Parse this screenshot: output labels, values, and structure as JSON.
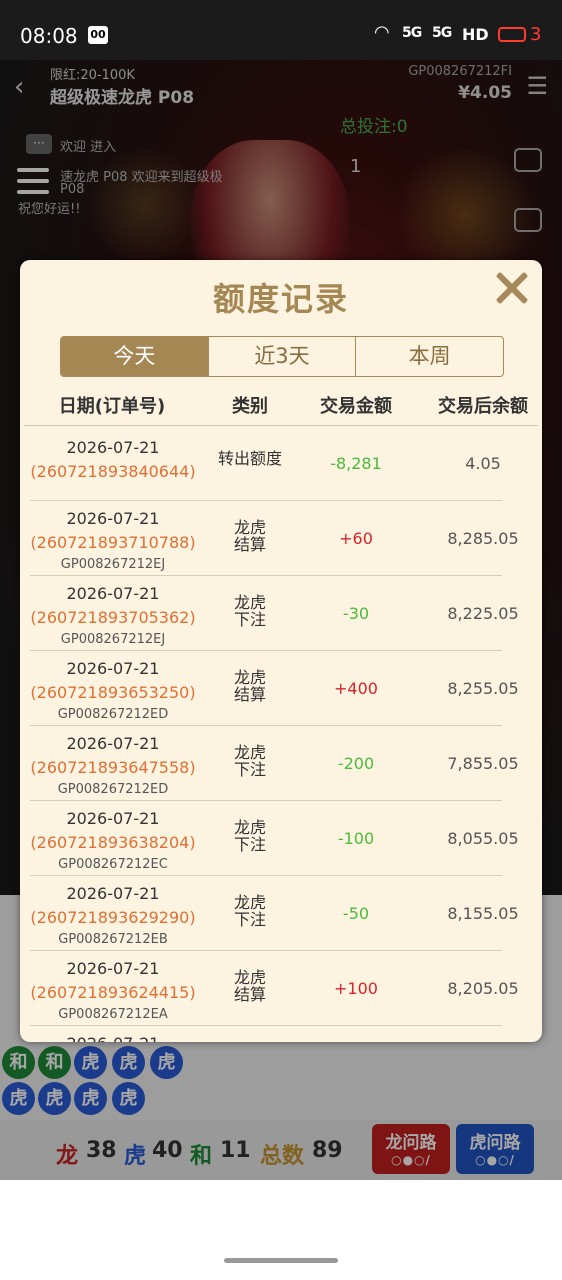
{
  "status_bar": {
    "time": "08:08",
    "app_icon": "00",
    "signal1": "5G",
    "signal2": "5G",
    "hd": "HD",
    "battery": "3"
  },
  "game": {
    "limit": "限红:20-100K",
    "title": "超级极速龙虎 P08",
    "gp_id": "GP008267212FI",
    "balance": "¥4.05",
    "total_bet": "总投注:0",
    "chat_line1": "欢迎 进入",
    "chat_line2": "速龙虎 P08 欢迎来到超级极",
    "chat_line3": "P08",
    "chat_line4": "祝您好运!!",
    "dealer_count": "1"
  },
  "dialog": {
    "title": "额度记录",
    "tabs": [
      {
        "label": "今天",
        "active": true
      },
      {
        "label": "近3天",
        "active": false
      },
      {
        "label": "本周",
        "active": false
      }
    ],
    "headers": {
      "date": "日期(订单号)",
      "type": "类别",
      "amount": "交易金额",
      "balance": "交易后余额"
    },
    "rows": [
      {
        "date": "2026-07-21",
        "order": "(260721893840644)",
        "gp": "",
        "type": "转出额度",
        "amount": "-8,281",
        "sign": "neg",
        "balance": "4.05"
      },
      {
        "date": "2026-07-21",
        "order": "(260721893710788)",
        "gp": "GP008267212EJ",
        "type": "龙虎\n结算",
        "amount": "+60",
        "sign": "pos",
        "balance": "8,285.05"
      },
      {
        "date": "2026-07-21",
        "order": "(260721893705362)",
        "gp": "GP008267212EJ",
        "type": "龙虎\n下注",
        "amount": "-30",
        "sign": "neg",
        "balance": "8,225.05"
      },
      {
        "date": "2026-07-21",
        "order": "(260721893653250)",
        "gp": "GP008267212ED",
        "type": "龙虎\n结算",
        "amount": "+400",
        "sign": "pos",
        "balance": "8,255.05"
      },
      {
        "date": "2026-07-21",
        "order": "(260721893647558)",
        "gp": "GP008267212ED",
        "type": "龙虎\n下注",
        "amount": "-200",
        "sign": "neg",
        "balance": "7,855.05"
      },
      {
        "date": "2026-07-21",
        "order": "(260721893638204)",
        "gp": "GP008267212EC",
        "type": "龙虎\n下注",
        "amount": "-100",
        "sign": "neg",
        "balance": "8,055.05"
      },
      {
        "date": "2026-07-21",
        "order": "(260721893629290)",
        "gp": "GP008267212EB",
        "type": "龙虎\n下注",
        "amount": "-50",
        "sign": "neg",
        "balance": "8,155.05"
      },
      {
        "date": "2026-07-21",
        "order": "(260721893624415)",
        "gp": "GP008267212EA",
        "type": "龙虎\n结算",
        "amount": "+100",
        "sign": "pos",
        "balance": "8,205.05"
      },
      {
        "date": "2026-07-21",
        "order": "",
        "gp": "",
        "type": "",
        "amount": "",
        "sign": "neg",
        "balance": ""
      }
    ]
  },
  "road": {
    "beads_row1": [
      "和",
      "和",
      "虎",
      "虎",
      "虎"
    ],
    "beads_row2": [
      "虎",
      "虎",
      "虎",
      "虎"
    ],
    "stats": {
      "dragon_label": "龙",
      "dragon_count": "38",
      "tiger_label": "虎",
      "tiger_count": "40",
      "tie_label": "和",
      "tie_count": "11",
      "total_label": "总数",
      "total_count": "89"
    },
    "ask_dragon": "龙问路",
    "ask_tiger": "虎问路"
  },
  "colors": {
    "gold": "#a58754",
    "positive": "#d8232a",
    "negative": "#4bbb3a",
    "order": "#e07033"
  }
}
